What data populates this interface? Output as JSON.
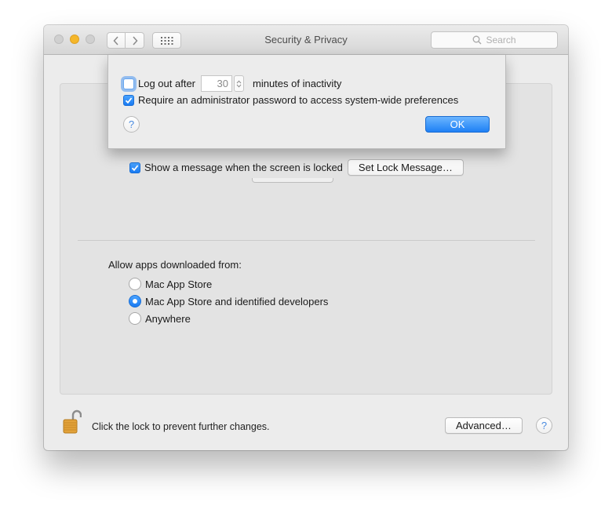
{
  "window": {
    "title": "Security & Privacy",
    "search_placeholder": "Search"
  },
  "general": {
    "show_message_checkbox": {
      "label": "Show a message when the screen is locked",
      "checked": true
    },
    "set_lock_message_button": "Set Lock Message…",
    "allow_apps_label": "Allow apps downloaded from:",
    "radio_options": [
      {
        "label": "Mac App Store",
        "selected": false
      },
      {
        "label": "Mac App Store and identified developers",
        "selected": true
      },
      {
        "label": "Anywhere",
        "selected": false
      }
    ]
  },
  "footer": {
    "lock_text": "Click the lock to prevent further changes.",
    "advanced_button": "Advanced…",
    "help_glyph": "?"
  },
  "sheet": {
    "logout_label": "Log out after",
    "logout_checked": false,
    "logout_minutes": "30",
    "minutes_label": "minutes of inactivity",
    "require_admin_label": "Require an administrator password to access system-wide preferences",
    "require_admin_checked": true,
    "help_glyph": "?",
    "ok_button": "OK"
  },
  "icons": {
    "back": "chevron-left-icon",
    "forward": "chevron-right-icon",
    "grid": "grid-icon",
    "search": "search-icon",
    "lock": "unlocked-padlock-icon",
    "check": "checkmark-icon"
  },
  "colors": {
    "accent": "#1e80f5",
    "minimize": "#f5b72a",
    "lock": "#e2a23a"
  }
}
